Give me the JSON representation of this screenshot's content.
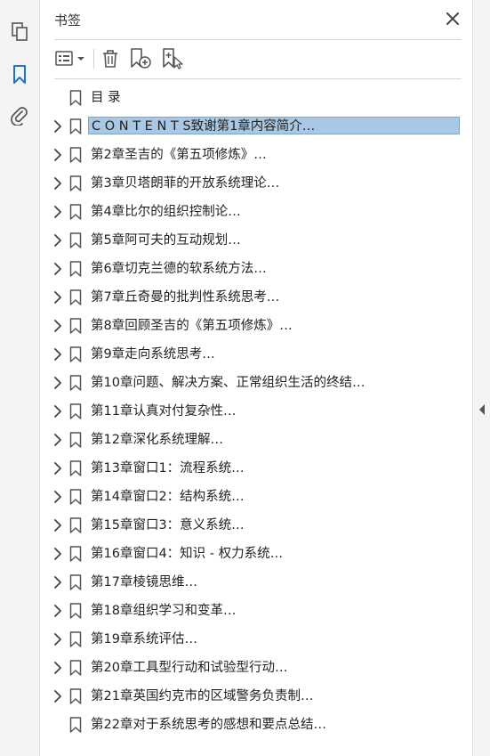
{
  "panel": {
    "title": "书签"
  },
  "items": [
    {
      "label": "目 录",
      "expandable": false,
      "selected": false
    },
    {
      "label": "C O N T E N T S致谢第1章内容简介…",
      "expandable": true,
      "selected": true
    },
    {
      "label": "第2章圣吉的《第五项修炼》…",
      "expandable": true,
      "selected": false
    },
    {
      "label": "第3章贝塔朗菲的开放系统理论…",
      "expandable": true,
      "selected": false
    },
    {
      "label": "第4章比尔的组织控制论…",
      "expandable": true,
      "selected": false
    },
    {
      "label": "第5章阿可夫的互动规划…",
      "expandable": true,
      "selected": false
    },
    {
      "label": "第6章切克兰德的软系统方法…",
      "expandable": true,
      "selected": false
    },
    {
      "label": "第7章丘奇曼的批判性系统思考…",
      "expandable": true,
      "selected": false
    },
    {
      "label": "第8章回顾圣吉的《第五项修炼》…",
      "expandable": true,
      "selected": false
    },
    {
      "label": "第9章走向系统思考…",
      "expandable": true,
      "selected": false
    },
    {
      "label": "第10章问题、解决方案、正常组织生活的终结…",
      "expandable": true,
      "selected": false
    },
    {
      "label": "第11章认真对付复杂性…",
      "expandable": true,
      "selected": false
    },
    {
      "label": "第12章深化系统理解…",
      "expandable": true,
      "selected": false
    },
    {
      "label": "第13章窗口1：流程系统…",
      "expandable": true,
      "selected": false
    },
    {
      "label": "第14章窗口2：结构系统…",
      "expandable": true,
      "selected": false
    },
    {
      "label": "第15章窗口3：意义系统…",
      "expandable": true,
      "selected": false
    },
    {
      "label": "第16章窗口4：知识 - 权力系统…",
      "expandable": true,
      "selected": false
    },
    {
      "label": "第17章棱镜思维…",
      "expandable": true,
      "selected": false
    },
    {
      "label": "第18章组织学习和变革…",
      "expandable": true,
      "selected": false
    },
    {
      "label": "第19章系统评估…",
      "expandable": true,
      "selected": false
    },
    {
      "label": "第20章工具型行动和试验型行动…",
      "expandable": true,
      "selected": false
    },
    {
      "label": "第21章英国约克市的区域警务负责制…",
      "expandable": true,
      "selected": false
    },
    {
      "label": "第22章对于系统思考的感想和要点总结…",
      "expandable": false,
      "selected": false
    }
  ],
  "icons": {
    "rail": [
      "pages-icon",
      "bookmark-icon",
      "attachment-icon"
    ],
    "toolbar": [
      "options-menu-icon",
      "delete-bookmark-icon",
      "new-bookmark-icon",
      "new-bookmark-from-structure-icon"
    ]
  },
  "colors": {
    "accent": "#1f73c8",
    "selection": "#a9c8e4",
    "icon": "#555555"
  }
}
